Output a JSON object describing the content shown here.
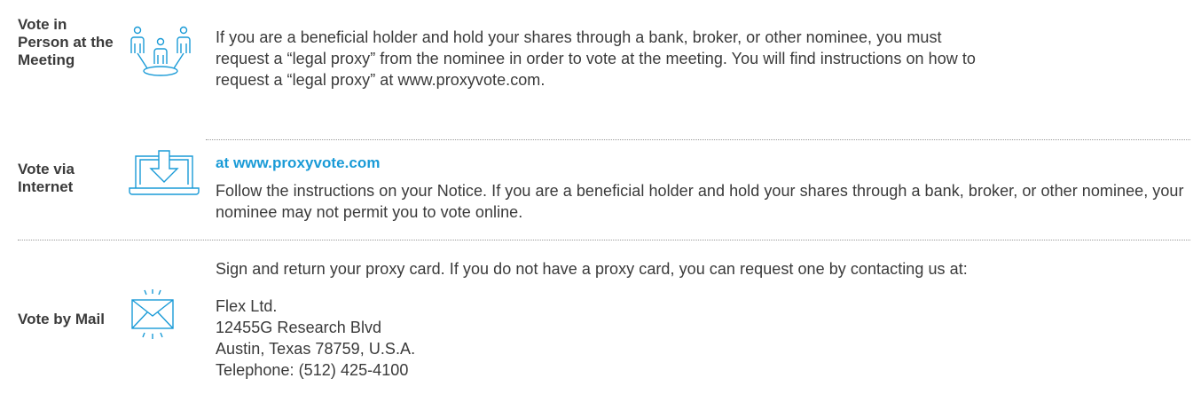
{
  "sections": [
    {
      "label": "Vote in Person at the Meeting",
      "icon": "people-icon",
      "text": "If you are a beneficial holder and hold your shares through a bank, broker, or other nominee, you must request a “legal proxy” from the nominee in order to vote at the meeting. You will find instructions on how to request a “legal proxy” at www.proxyvote.com."
    },
    {
      "label": "Vote via Internet",
      "icon": "laptop-download-icon",
      "heading": "at www.proxyvote.com",
      "text": "Follow the instructions on your Notice. If you are a beneficial holder and hold your shares through a bank, broker, or other nominee, your nominee may not permit you to vote online."
    },
    {
      "label": "Vote by Mail",
      "icon": "envelope-icon",
      "text": "Sign and return your proxy card. If you do not have a proxy card, you can request one by contacting us at:",
      "address": [
        "Flex Ltd.",
        "12455G Research Blvd",
        "Austin, Texas 78759, U.S.A.",
        "Telephone: (512) 425-4100"
      ]
    }
  ],
  "colors": {
    "accent": "#1a9bd7",
    "text": "#3a3a3a"
  }
}
